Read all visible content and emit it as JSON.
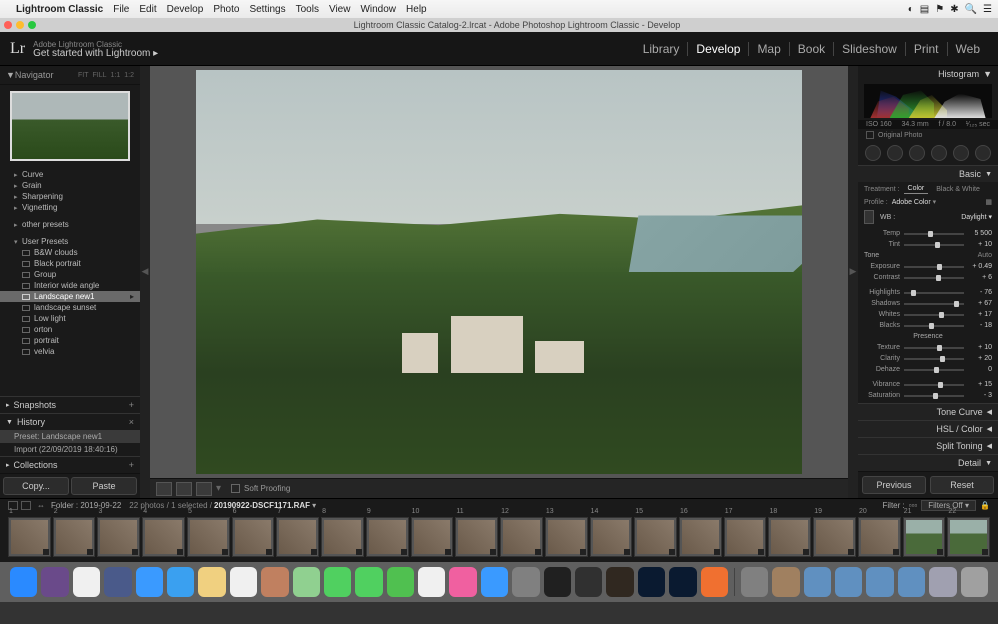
{
  "mac": {
    "app": "Lightroom Classic",
    "menus": [
      "File",
      "Edit",
      "Develop",
      "Photo",
      "Settings",
      "Tools",
      "View",
      "Window",
      "Help"
    ],
    "status_icons": [
      "wifi",
      "battery",
      "flag",
      "clock",
      "spotlight",
      "menu"
    ]
  },
  "titlebar": "Lightroom Classic Catalog-2.lrcat - Adobe Photoshop Lightroom Classic - Develop",
  "header": {
    "logo": "Lr",
    "tagline_small": "Adobe Lightroom Classic",
    "tagline": "Get started with Lightroom  ▸",
    "modules": [
      "Library",
      "Develop",
      "Map",
      "Book",
      "Slideshow",
      "Print",
      "Web"
    ],
    "active_module": "Develop"
  },
  "left": {
    "navigator": {
      "label": "Navigator",
      "zooms": [
        "FIT",
        "FILL",
        "1:1",
        "1:2"
      ]
    },
    "preset_groups": [
      "Curve",
      "Grain",
      "Sharpening",
      "Vignetting"
    ],
    "other_presets": "other presets",
    "user_presets_label": "User Presets",
    "user_presets": [
      "B&W clouds",
      "Black portrait",
      "Group",
      "Interior wide angle",
      "Landscape new1",
      "landscape sunset",
      "Low light",
      "orton",
      "portrait",
      "velvia"
    ],
    "selected_preset": "Landscape new1",
    "snapshots": "Snapshots",
    "history": "History",
    "history_items": [
      "Preset: Landscape new1",
      "Import (22/09/2019 18:40:16)"
    ],
    "collections": "Collections",
    "copy": "Copy...",
    "paste": "Paste"
  },
  "center": {
    "soft_proofing": "Soft Proofing"
  },
  "right": {
    "histogram": "Histogram",
    "exif": {
      "iso": "ISO 160",
      "focal": "34.3 mm",
      "aperture": "f / 8.0",
      "shutter": "¹⁄₁₂₅ sec"
    },
    "original_photo": "Original Photo",
    "switch_label": "",
    "basic": "Basic",
    "treatment": {
      "label": "Treatment :",
      "color": "Color",
      "bw": "Black & White"
    },
    "profile": {
      "label": "Profile :",
      "value": "Adobe Color"
    },
    "wb": {
      "label": "WB :",
      "value": "Daylight"
    },
    "temp": {
      "label": "Temp",
      "value": "5 500"
    },
    "tint": {
      "label": "Tint",
      "value": "+ 10"
    },
    "tone": "Tone",
    "auto": "Auto",
    "exposure": {
      "label": "Exposure",
      "value": "+ 0.49"
    },
    "contrast": {
      "label": "Contrast",
      "value": "+ 6"
    },
    "highlights": {
      "label": "Highlights",
      "value": "- 76"
    },
    "shadows": {
      "label": "Shadows",
      "value": "+ 67"
    },
    "whites": {
      "label": "Whites",
      "value": "+ 17"
    },
    "blacks": {
      "label": "Blacks",
      "value": "- 18"
    },
    "presence": "Presence",
    "texture": {
      "label": "Texture",
      "value": "+ 10"
    },
    "clarity": {
      "label": "Clarity",
      "value": "+ 20"
    },
    "dehaze": {
      "label": "Dehaze",
      "value": "0"
    },
    "vibrance": {
      "label": "Vibrance",
      "value": "+ 15"
    },
    "saturation": {
      "label": "Saturation",
      "value": "- 3"
    },
    "tone_curve": "Tone Curve",
    "hsl": "HSL / Color",
    "split": "Split Toning",
    "detail": "Detail",
    "previous": "Previous",
    "reset": "Reset"
  },
  "strip": {
    "folder_label": "Folder : 2019-09-22",
    "count": "22 photos / 1 selected /",
    "filename": "20190922-DSCF1171.RAF",
    "filter_label": "Filter :",
    "filters_off": "Filters Off",
    "thumbs": 22
  },
  "dock": {
    "apps": [
      {
        "n": "finder",
        "c": "#2a8aff"
      },
      {
        "n": "dashboard",
        "c": "#6a4a8a"
      },
      {
        "n": "chrome",
        "c": "#f0f0f0"
      },
      {
        "n": "firefox-dev",
        "c": "#4a5a8a"
      },
      {
        "n": "safari",
        "c": "#3a9aff"
      },
      {
        "n": "mail",
        "c": "#3aa0f0"
      },
      {
        "n": "notes",
        "c": "#f0d080"
      },
      {
        "n": "calendar",
        "c": "#f0f0f0"
      },
      {
        "n": "contacts",
        "c": "#c08060"
      },
      {
        "n": "maps",
        "c": "#90d090"
      },
      {
        "n": "messages",
        "c": "#50d060"
      },
      {
        "n": "facetime",
        "c": "#50d060"
      },
      {
        "n": "wechat",
        "c": "#50c050"
      },
      {
        "n": "photos",
        "c": "#f0f0f0"
      },
      {
        "n": "itunes",
        "c": "#f060a0"
      },
      {
        "n": "appstore",
        "c": "#3a9aff"
      },
      {
        "n": "preferences",
        "c": "#808080"
      },
      {
        "n": "terminal",
        "c": "#202020"
      },
      {
        "n": "steam",
        "c": "#303030"
      },
      {
        "n": "bridge",
        "c": "#302820"
      },
      {
        "n": "lightroom",
        "c": "#0a1a30"
      },
      {
        "n": "photoshop",
        "c": "#0a1a30"
      },
      {
        "n": "firefox",
        "c": "#f07030"
      }
    ],
    "right": [
      {
        "n": "download",
        "c": "#808080"
      },
      {
        "n": "box",
        "c": "#a08060"
      },
      {
        "n": "folder1",
        "c": "#6090c0"
      },
      {
        "n": "folder2",
        "c": "#6090c0"
      },
      {
        "n": "folder3",
        "c": "#6090c0"
      },
      {
        "n": "folder4",
        "c": "#6090c0"
      },
      {
        "n": "stack",
        "c": "#a0a0b0"
      },
      {
        "n": "trash",
        "c": "#a0a0a0"
      }
    ]
  }
}
